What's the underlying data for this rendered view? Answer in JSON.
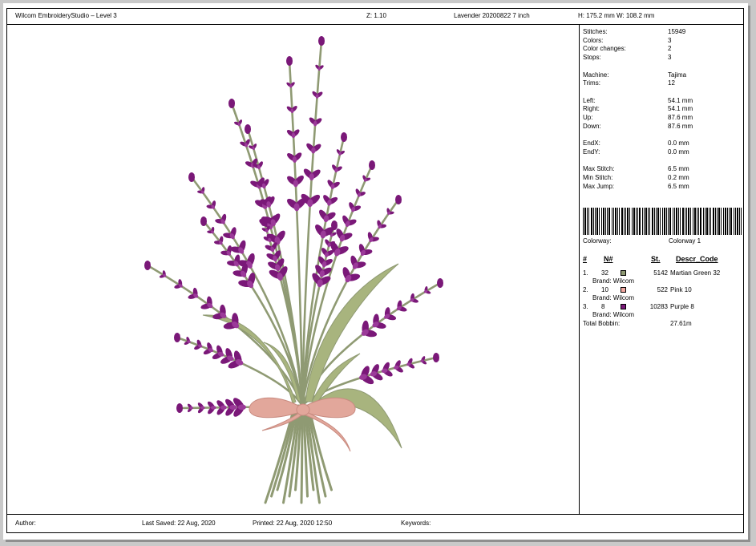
{
  "header": {
    "app_title": "Wilcom EmbroideryStudio – Level 3",
    "zoom": "Z: 1.10",
    "design_name": "Lavender 20200822 7 inch",
    "size": "H: 175.2 mm   W: 108.2 mm"
  },
  "stats": [
    {
      "label": "Stitches:",
      "value": "15949"
    },
    {
      "label": "Colors:",
      "value": "3"
    },
    {
      "label": "Color changes:",
      "value": "2"
    },
    {
      "label": "Stops:",
      "value": "3"
    },
    {
      "label": "Machine:",
      "value": "Tajima"
    },
    {
      "label": "Trims:",
      "value": "12"
    },
    {
      "label": "Left:",
      "value": "54.1 mm"
    },
    {
      "label": "Right:",
      "value": "54.1 mm"
    },
    {
      "label": "Up:",
      "value": "87.6 mm"
    },
    {
      "label": "Down:",
      "value": "87.6 mm"
    },
    {
      "label": "EndX:",
      "value": "0.0 mm"
    },
    {
      "label": "EndY:",
      "value": "0.0 mm"
    },
    {
      "label": "Max Stitch:",
      "value": "6.5 mm"
    },
    {
      "label": "Min Stitch:",
      "value": "0.2 mm"
    },
    {
      "label": "Max Jump:",
      "value": "6.5 mm"
    }
  ],
  "colorway": {
    "label": "Colorway:",
    "value": "Colorway 1"
  },
  "color_table": {
    "headers": {
      "num": "#",
      "n": "N#",
      "st": "St.",
      "descr": "Descr_Code"
    },
    "rows": [
      {
        "idx": "1.",
        "n": "32",
        "color": "#8f9a73",
        "st": "5142",
        "descr": "Martian Green 32",
        "brand": "Brand: Wilcom"
      },
      {
        "idx": "2.",
        "n": "10",
        "color": "#f2a7a0",
        "st": "522",
        "descr": "Pink 10",
        "brand": "Brand: Wilcom"
      },
      {
        "idx": "3.",
        "n": "8",
        "color": "#7a1878",
        "st": "10283",
        "descr": "Purple 8",
        "brand": "Brand: Wilcom"
      }
    ],
    "total_label": "Total Bobbin:",
    "total_value": "27.61m"
  },
  "footer": {
    "author": "Author:",
    "last_saved": "Last Saved: 22 Aug, 2020",
    "printed": "Printed: 22 Aug, 2020 12:50",
    "keywords": "Keywords:"
  },
  "colors": {
    "lavender": "#7a1878",
    "lavender_highlight": "#9b3a99",
    "stem": "#8f9a73",
    "leaf": "#a8b47e",
    "ribbon": "#e2a79b"
  },
  "icons": [
    "barcode-icon"
  ]
}
